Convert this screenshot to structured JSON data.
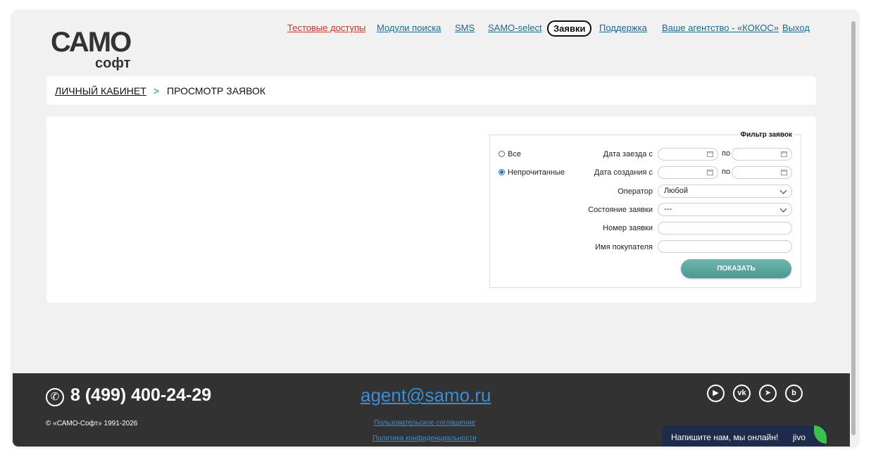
{
  "logo": {
    "top": "САМО",
    "bottom": "софт"
  },
  "nav": {
    "items": [
      {
        "label": "Тестовые доступы",
        "style": "red"
      },
      {
        "label": "Модули поиска",
        "style": "link"
      },
      {
        "label": "SMS",
        "style": "link"
      },
      {
        "label": "SAMO-select",
        "style": "link"
      },
      {
        "label": "Заявки",
        "style": "active"
      },
      {
        "label": "Поддержка",
        "style": "link"
      },
      {
        "label": "Ваше агентство - «КОКОС»",
        "style": "link"
      },
      {
        "label": "Выход",
        "style": "link"
      }
    ]
  },
  "breadcrumb": {
    "home": "Личный кабинет",
    "separator": ">",
    "current": "Просмотр заявок"
  },
  "filter": {
    "title": "Фильтр заявок",
    "radio_all": "Все",
    "radio_unread": "Непрочитанные",
    "selected_radio": "unread",
    "checkin_label": "Дата заезда с",
    "created_label": "Дата создания с",
    "to_label": "по",
    "operator_label": "Оператор",
    "operator_value": "Любой",
    "status_label": "Состояние заявки",
    "status_value": "---",
    "number_label": "Номер заявки",
    "buyer_label": "Имя покупателя",
    "show_button": "ПОКАЗАТЬ"
  },
  "footer": {
    "phone": "8 (499) 400-24-29",
    "copyright": "© «САМО-Софт» 1991-2026",
    "email": "agent@samo.ru",
    "links": [
      "Пользовательское соглашение",
      "Политика конфиденциальности"
    ],
    "social": [
      "youtube-icon",
      "vk-icon",
      "telegram-icon",
      "blog-icon"
    ]
  },
  "chat": {
    "text": "Напишите нам, мы онлайн!",
    "brand": "jivo"
  },
  "colors": {
    "accent": "#4a9890",
    "link": "#1a6a8f",
    "red_link": "#d0312d",
    "footer_bg": "#323232",
    "chat_bg": "#1f2b4a"
  }
}
